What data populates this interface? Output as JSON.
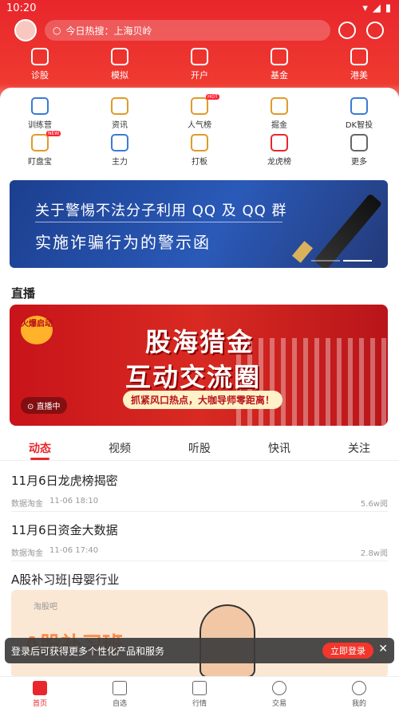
{
  "status": {
    "time": "10:20"
  },
  "header": {
    "search_text": "今日热搜：上海贝岭"
  },
  "top_nav": [
    {
      "label": "诊股",
      "icon": "robot-icon"
    },
    {
      "label": "模拟",
      "icon": "simulate-icon"
    },
    {
      "label": "开户",
      "icon": "account-icon"
    },
    {
      "label": "基金",
      "icon": "fund-icon"
    },
    {
      "label": "港美",
      "icon": "hk-us-icon"
    }
  ],
  "grid": [
    {
      "label": "训练营",
      "icon": "camp-icon",
      "badge": ""
    },
    {
      "label": "资讯",
      "icon": "news-icon",
      "badge": ""
    },
    {
      "label": "人气榜",
      "icon": "popular-icon",
      "badge": "HOT"
    },
    {
      "label": "掘金",
      "icon": "gold-icon",
      "badge": ""
    },
    {
      "label": "DK智投",
      "icon": "dk-icon",
      "badge": ""
    },
    {
      "label": "盯盘宝",
      "icon": "watch-icon",
      "badge": "NEW"
    },
    {
      "label": "主力",
      "icon": "main-force-icon",
      "badge": ""
    },
    {
      "label": "打板",
      "icon": "board-icon",
      "badge": ""
    },
    {
      "label": "龙虎榜",
      "icon": "trophy-icon",
      "badge": ""
    },
    {
      "label": "更多",
      "icon": "more-icon",
      "badge": ""
    }
  ],
  "banner": {
    "line1": "关于警惕不法分子利用 QQ 及 QQ 群",
    "line2": "实施诈骗行为的警示函"
  },
  "live": {
    "section_title": "直播",
    "hot_tag": "火爆启动",
    "title1": "股海猎金",
    "title2": "互动交流圈",
    "subtitle": "抓紧风口热点，大咖导师零距离！",
    "status": "直播中"
  },
  "tabs": [
    "动态",
    "视频",
    "听股",
    "快讯",
    "关注"
  ],
  "news": [
    {
      "title": "11月6日龙虎榜揭密",
      "source": "数据淘金",
      "time": "11-06 18:10",
      "views": "5.6w阅"
    },
    {
      "title": "11月6日资金大数据",
      "source": "数据淘金",
      "time": "11-06 17:40",
      "views": "2.8w阅"
    }
  ],
  "promo": {
    "title": "A股补习班|母婴行业",
    "image_title": "A股补习班",
    "logo": "淘股吧"
  },
  "toast": {
    "text": "登录后可获得更多个性化产品和服务",
    "button": "立即登录",
    "close": "✕"
  },
  "bottom_nav": [
    "首页",
    "自选",
    "行情",
    "交易",
    "我的"
  ]
}
